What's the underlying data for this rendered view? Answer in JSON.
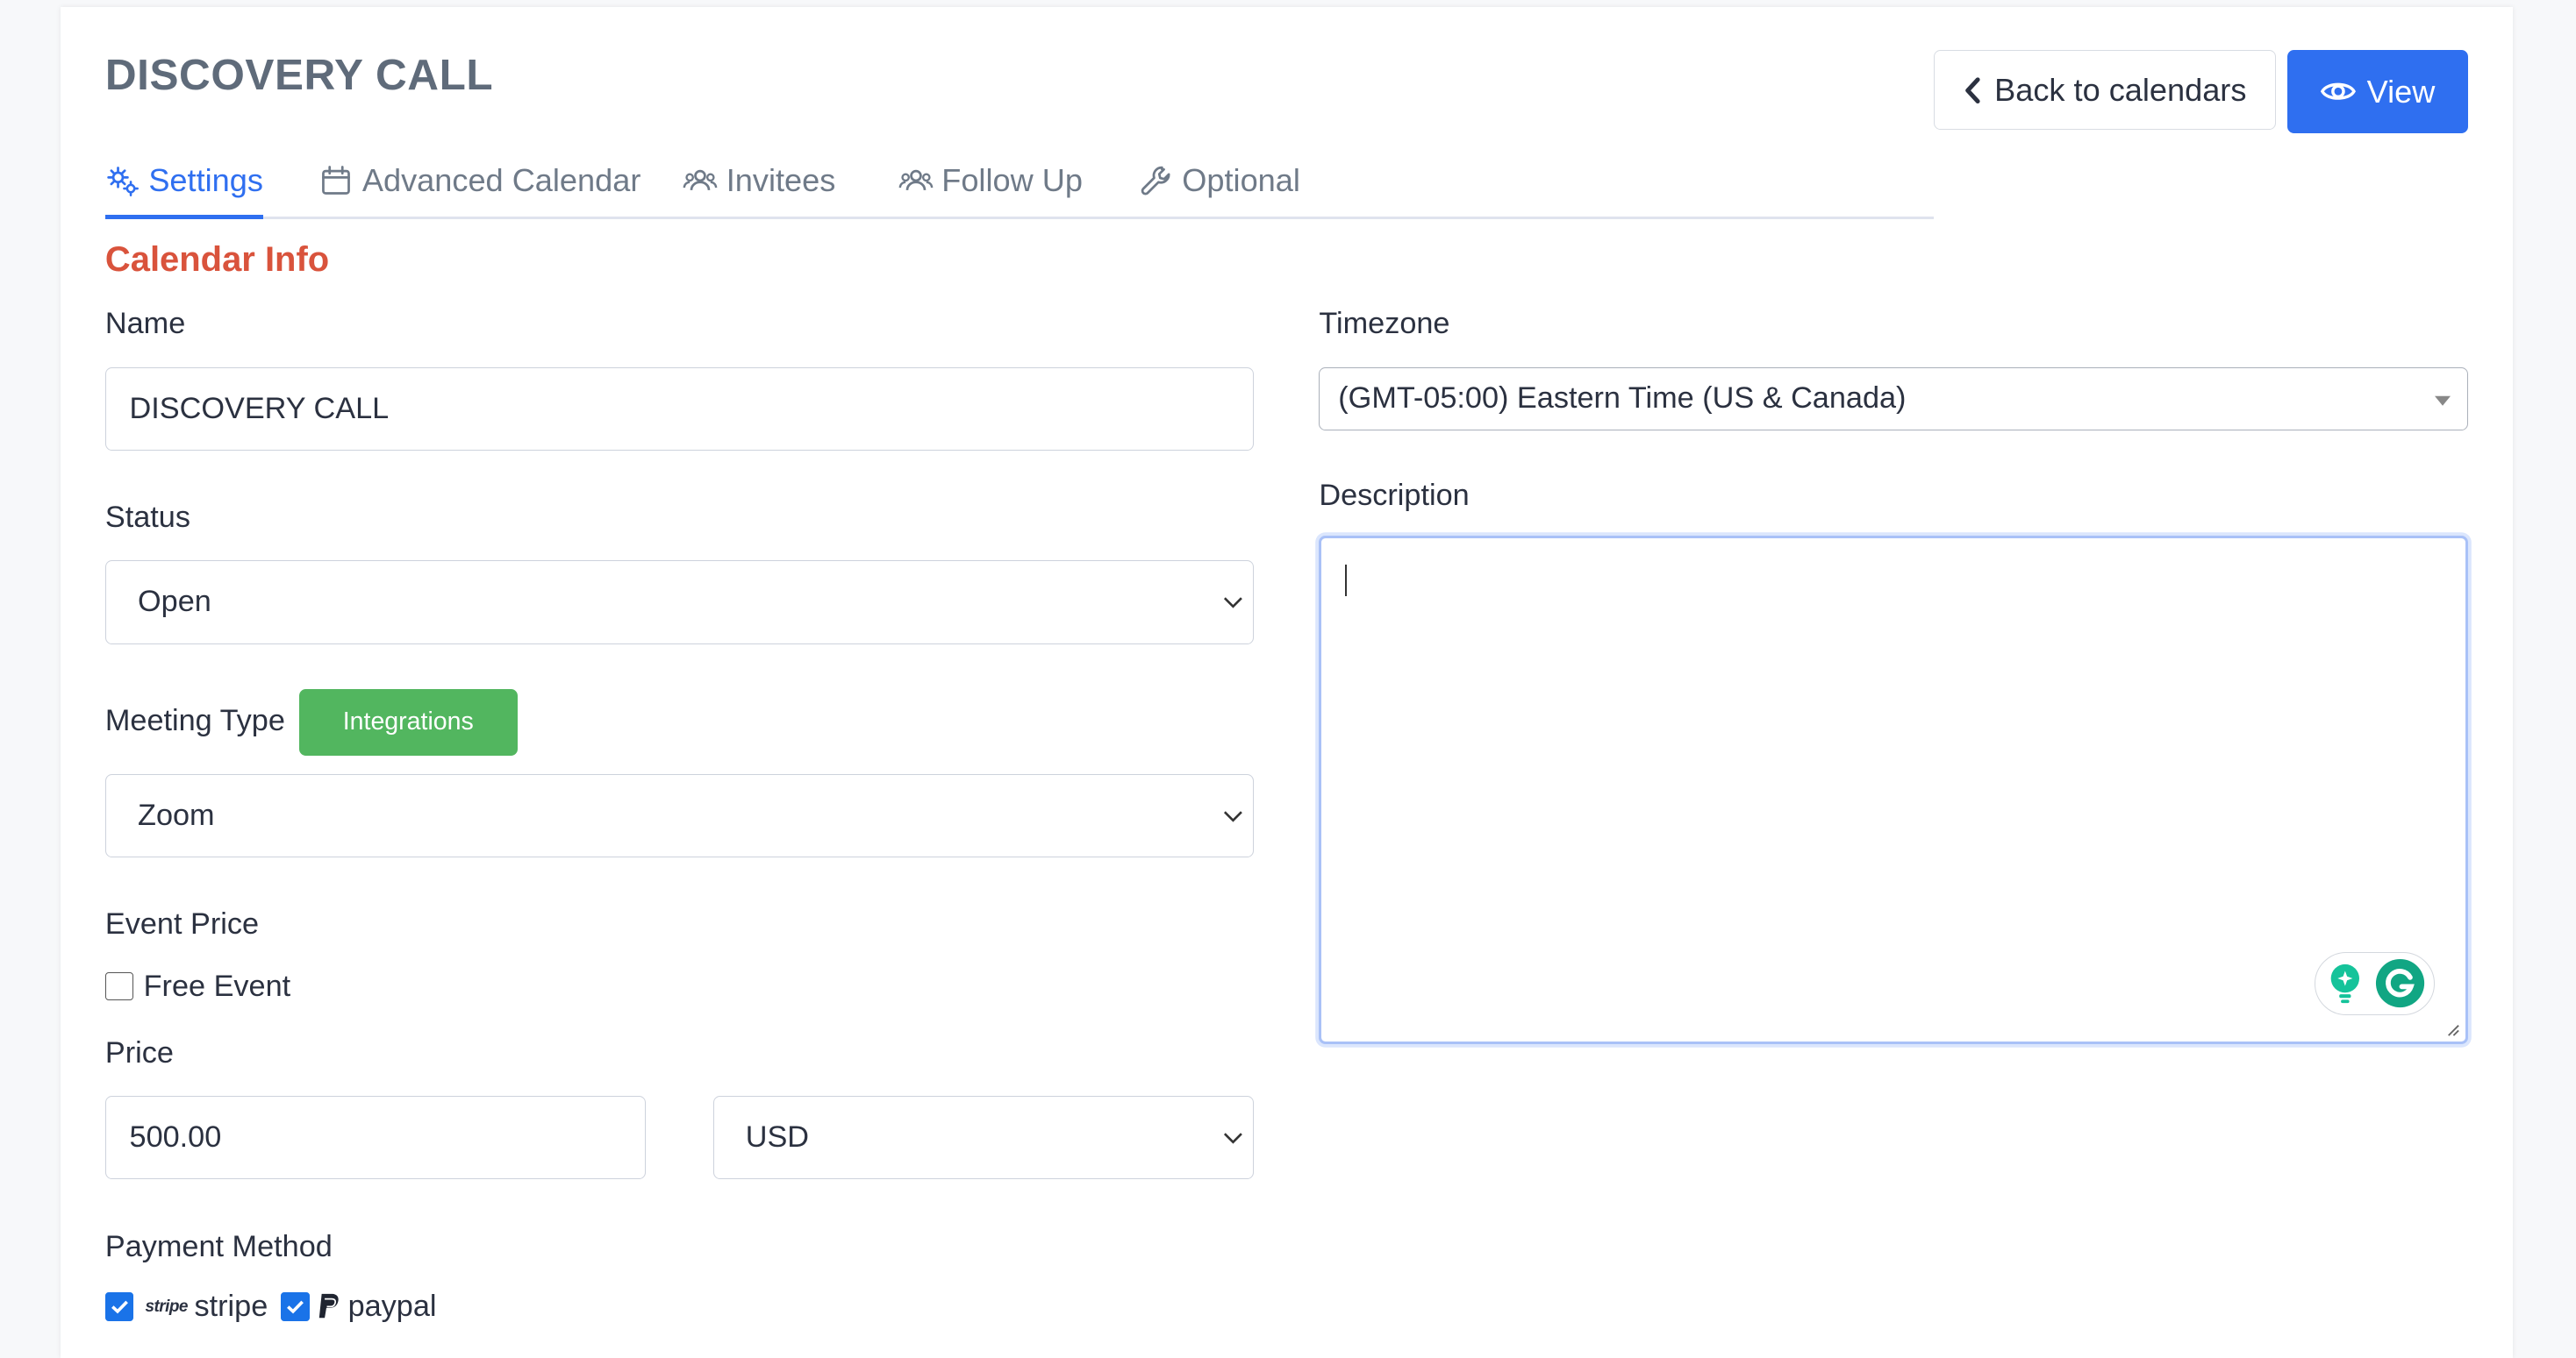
{
  "page": {
    "title": "DISCOVERY CALL"
  },
  "header": {
    "back_label": "Back to calendars",
    "view_label": "View"
  },
  "tabs": [
    {
      "label": "Settings",
      "icon": "gears-icon",
      "active": true
    },
    {
      "label": "Advanced Calendar",
      "icon": "calendar-icon",
      "active": false
    },
    {
      "label": "Invitees",
      "icon": "users-icon",
      "active": false
    },
    {
      "label": "Follow Up",
      "icon": "users-icon",
      "active": false
    },
    {
      "label": "Optional",
      "icon": "wrench-icon",
      "active": false
    }
  ],
  "section": {
    "title": "Calendar Info"
  },
  "form": {
    "name": {
      "label": "Name",
      "value": "DISCOVERY CALL"
    },
    "status": {
      "label": "Status",
      "value": "Open"
    },
    "meeting_type": {
      "label": "Meeting Type",
      "integrations_label": "Integrations",
      "value": "Zoom"
    },
    "event_price": {
      "label": "Event Price",
      "free_event_label": "Free Event",
      "free_event_checked": false
    },
    "price": {
      "label": "Price",
      "value": "500.00",
      "currency": "USD"
    },
    "payment_method": {
      "label": "Payment Method",
      "stripe_logo": "stripe",
      "stripe_label": "stripe",
      "stripe_checked": true,
      "paypal_label": "paypal",
      "paypal_checked": true
    },
    "timezone": {
      "label": "Timezone",
      "value": "(GMT-05:00) Eastern Time (US & Canada)"
    },
    "description": {
      "label": "Description",
      "value": ""
    }
  },
  "colors": {
    "primary": "#2f6ff0",
    "section_title": "#d9533c",
    "integrations": "#52b65f",
    "focus_border": "#a9c1f7"
  }
}
